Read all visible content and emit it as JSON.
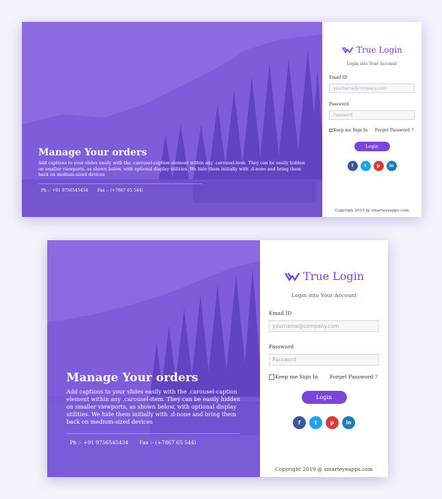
{
  "brand": {
    "name": "True Login",
    "color": "#6f47d0"
  },
  "hero": {
    "title": "Manage Your orders",
    "text": "Add captions to your slides easily with the .carousel-caption element within any .carousel-item. They can be easily hidden on smaller viewports, as shown below, with optional display utilities. We hide them initially with .d-none and bring them back on medium-sized devices",
    "phone": "Ph :- +91 9756545434",
    "fax": "Fax :- (+7867 65 544)",
    "overlay_color": "#7e58da"
  },
  "form": {
    "subtitle": "Login into Your Account",
    "email_label": "Email ID",
    "email_placeholder": "yourname@company.com",
    "password_label": "Password",
    "password_placeholder": "Password",
    "keep_signed_in": "Keep me Sign In",
    "forgot_password": "Forget Password ?",
    "login_button": "Login",
    "accent": "#7c45d9"
  },
  "socials": [
    {
      "icon": "facebook-icon",
      "glyph": "f",
      "color": "#3b5998"
    },
    {
      "icon": "twitter-icon",
      "glyph": "t",
      "color": "#1da1f2"
    },
    {
      "icon": "pinterest-icon",
      "glyph": "p",
      "color": "#d93a3a"
    },
    {
      "icon": "linkedin-icon",
      "glyph": "in",
      "color": "#1f7bb6"
    }
  ],
  "footer": "Copyrigh 2019 @ smarteyeapps.com",
  "footer_large": "Copyright 2019 @ smarteyeapps.com"
}
